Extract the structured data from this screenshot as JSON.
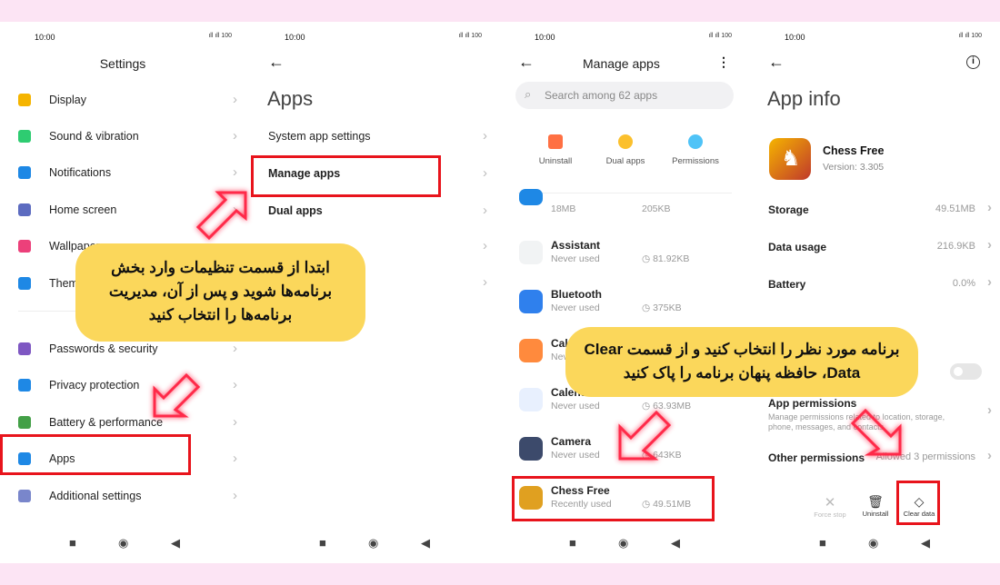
{
  "status": {
    "time": "10:00",
    "signal": "ıll ıll 100"
  },
  "screen1": {
    "title": "Settings",
    "items": [
      {
        "label": "Display",
        "color": "#f5b400"
      },
      {
        "label": "Sound & vibration",
        "color": "#2ecc71"
      },
      {
        "label": "Notifications",
        "color": "#1e88e5"
      },
      {
        "label": "Home screen",
        "color": "#5c6bc0"
      },
      {
        "label": "Wallpaper",
        "color": "#ec407a"
      },
      {
        "label": "Themes",
        "color": "#1e88e5"
      },
      {
        "label": "Passwords & security",
        "color": "#7e57c2"
      },
      {
        "label": "Privacy protection",
        "color": "#1e88e5"
      },
      {
        "label": "Battery & performance",
        "color": "#43a047"
      },
      {
        "label": "Apps",
        "color": "#1e88e5"
      },
      {
        "label": "Additional settings",
        "color": "#7986cb"
      }
    ]
  },
  "screen2": {
    "title": "Apps",
    "items": [
      "System app settings",
      "Manage apps",
      "Dual apps"
    ]
  },
  "screen3": {
    "title": "Manage apps",
    "search_placeholder": "Search among 62 apps",
    "actions": [
      {
        "label": "Uninstall",
        "color": "#ff7043"
      },
      {
        "label": "Dual apps",
        "color": "#fbc02d"
      },
      {
        "label": "Permissions",
        "color": "#4fc3f7"
      }
    ],
    "partial": {
      "sub": "18MB",
      "size": "205KB"
    },
    "apps": [
      {
        "name": "Assistant",
        "sub": "Never used",
        "size": "81.92KB",
        "color": "#f1f3f4"
      },
      {
        "name": "Bluetooth",
        "sub": "Never used",
        "size": "375KB",
        "color": "#2f80ed"
      },
      {
        "name": "Calculator",
        "sub": "Never used",
        "size": "",
        "color": "#ff8a3d"
      },
      {
        "name": "Calendar",
        "sub": "Never used",
        "size": "63.93MB",
        "color": "#e8f0fe"
      },
      {
        "name": "Camera",
        "sub": "Never used",
        "size": "643KB",
        "color": "#3c4a6b"
      },
      {
        "name": "Chess Free",
        "sub": "Recently used",
        "size": "49.51MB",
        "color": "#e0a020"
      }
    ]
  },
  "screen4": {
    "title": "App info",
    "app_name": "Chess Free",
    "version": "Version: 3.305",
    "rows": [
      {
        "label": "Storage",
        "value": "49.51MB"
      },
      {
        "label": "Data usage",
        "value": "216.9KB"
      },
      {
        "label": "Battery",
        "value": "0.0%"
      }
    ],
    "permissions_title": "App permissions",
    "permissions_desc": "Manage permissions related to location, storage, phone, messages, and contacts",
    "other_permissions": "Other permissions",
    "other_value": "Allowed 3 permissions",
    "buttons": [
      "Force stop",
      "Uninstall",
      "Clear data"
    ]
  },
  "bubble1": "ابتدا از قسمت تنظیمات وارد بخش برنامه‌ها شوید و پس از آن، مدیریت برنامه‌ها را انتخاب کنید",
  "bubble2": "برنامه مورد نظر را انتخاب کنید و  از قسمت Clear Data، حافظه پنهان برنامه را پاک کنید",
  "colors": {
    "highlight": "#e8141c",
    "bubble": "#fbd75b",
    "background": "#fce4f4"
  }
}
